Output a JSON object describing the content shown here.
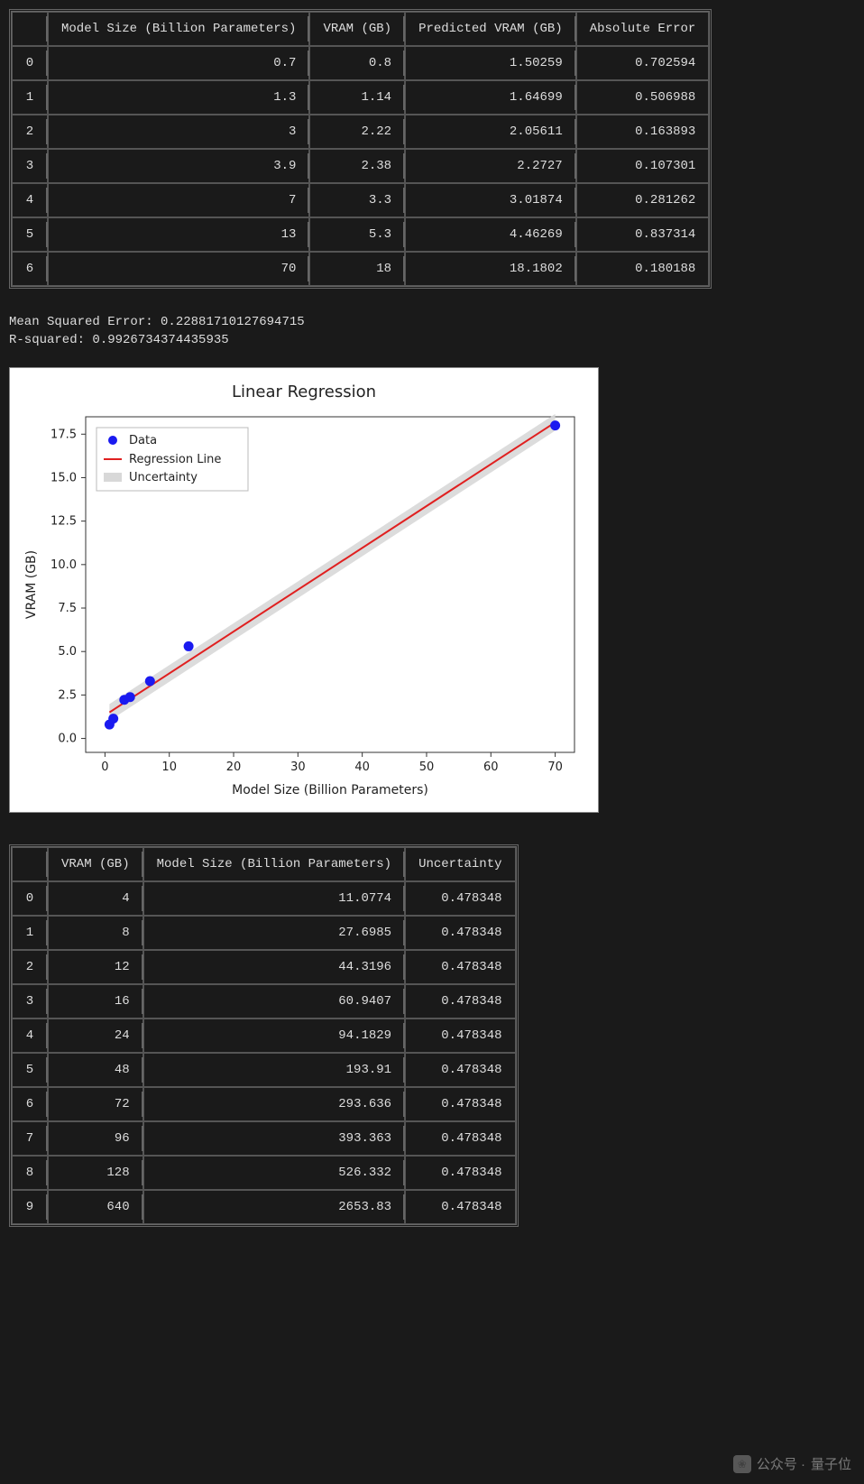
{
  "table1": {
    "headers": [
      "",
      "Model Size (Billion Parameters)",
      "VRAM (GB)",
      "Predicted VRAM (GB)",
      "Absolute Error"
    ],
    "rows": [
      {
        "idx": "0",
        "model_size": "0.7",
        "vram": "0.8",
        "pred": "1.50259",
        "err": "0.702594"
      },
      {
        "idx": "1",
        "model_size": "1.3",
        "vram": "1.14",
        "pred": "1.64699",
        "err": "0.506988"
      },
      {
        "idx": "2",
        "model_size": "3",
        "vram": "2.22",
        "pred": "2.05611",
        "err": "0.163893"
      },
      {
        "idx": "3",
        "model_size": "3.9",
        "vram": "2.38",
        "pred": "2.2727",
        "err": "0.107301"
      },
      {
        "idx": "4",
        "model_size": "7",
        "vram": "3.3",
        "pred": "3.01874",
        "err": "0.281262"
      },
      {
        "idx": "5",
        "model_size": "13",
        "vram": "5.3",
        "pred": "4.46269",
        "err": "0.837314"
      },
      {
        "idx": "6",
        "model_size": "70",
        "vram": "18",
        "pred": "18.1802",
        "err": "0.180188"
      }
    ]
  },
  "stats": {
    "mse_label": "Mean Squared Error: ",
    "mse_value": "0.22881710127694715",
    "r2_label": "R-squared: ",
    "r2_value": "0.9926734374435935"
  },
  "chart_data": {
    "type": "scatter",
    "title": "Linear Regression",
    "xlabel": "Model Size (Billion Parameters)",
    "ylabel": "VRAM (GB)",
    "xlim": [
      0,
      70
    ],
    "ylim": [
      0,
      18
    ],
    "xticks": [
      0,
      10,
      20,
      30,
      40,
      50,
      60,
      70
    ],
    "yticks": [
      0.0,
      2.5,
      5.0,
      7.5,
      10.0,
      12.5,
      15.0,
      17.5
    ],
    "legend": [
      "Data",
      "Regression Line",
      "Uncertainty"
    ],
    "series": [
      {
        "name": "Data",
        "type": "scatter",
        "x": [
          0.7,
          1.3,
          3,
          3.9,
          7,
          13,
          70
        ],
        "y": [
          0.8,
          1.14,
          2.22,
          2.38,
          3.3,
          5.3,
          18
        ],
        "color": "#1a1af0"
      },
      {
        "name": "Regression Line",
        "type": "line",
        "x": [
          0.7,
          70
        ],
        "y": [
          1.50259,
          18.1802
        ],
        "color": "#e02020"
      },
      {
        "name": "Uncertainty",
        "type": "band",
        "x": [
          0.7,
          70
        ],
        "y_lo": [
          1.02,
          17.7
        ],
        "y_hi": [
          1.98,
          18.66
        ],
        "color": "#d0d0d0"
      }
    ]
  },
  "table2": {
    "headers": [
      "",
      "VRAM (GB)",
      "Model Size (Billion Parameters)",
      "Uncertainty"
    ],
    "rows": [
      {
        "idx": "0",
        "vram": "4",
        "model_size": "11.0774",
        "unc": "0.478348"
      },
      {
        "idx": "1",
        "vram": "8",
        "model_size": "27.6985",
        "unc": "0.478348"
      },
      {
        "idx": "2",
        "vram": "12",
        "model_size": "44.3196",
        "unc": "0.478348"
      },
      {
        "idx": "3",
        "vram": "16",
        "model_size": "60.9407",
        "unc": "0.478348"
      },
      {
        "idx": "4",
        "vram": "24",
        "model_size": "94.1829",
        "unc": "0.478348"
      },
      {
        "idx": "5",
        "vram": "48",
        "model_size": "193.91",
        "unc": "0.478348"
      },
      {
        "idx": "6",
        "vram": "72",
        "model_size": "293.636",
        "unc": "0.478348"
      },
      {
        "idx": "7",
        "vram": "96",
        "model_size": "393.363",
        "unc": "0.478348"
      },
      {
        "idx": "8",
        "vram": "128",
        "model_size": "526.332",
        "unc": "0.478348"
      },
      {
        "idx": "9",
        "vram": "640",
        "model_size": "2653.83",
        "unc": "0.478348"
      }
    ]
  },
  "watermark": {
    "prefix": "公众号 · ",
    "name": "量子位"
  }
}
